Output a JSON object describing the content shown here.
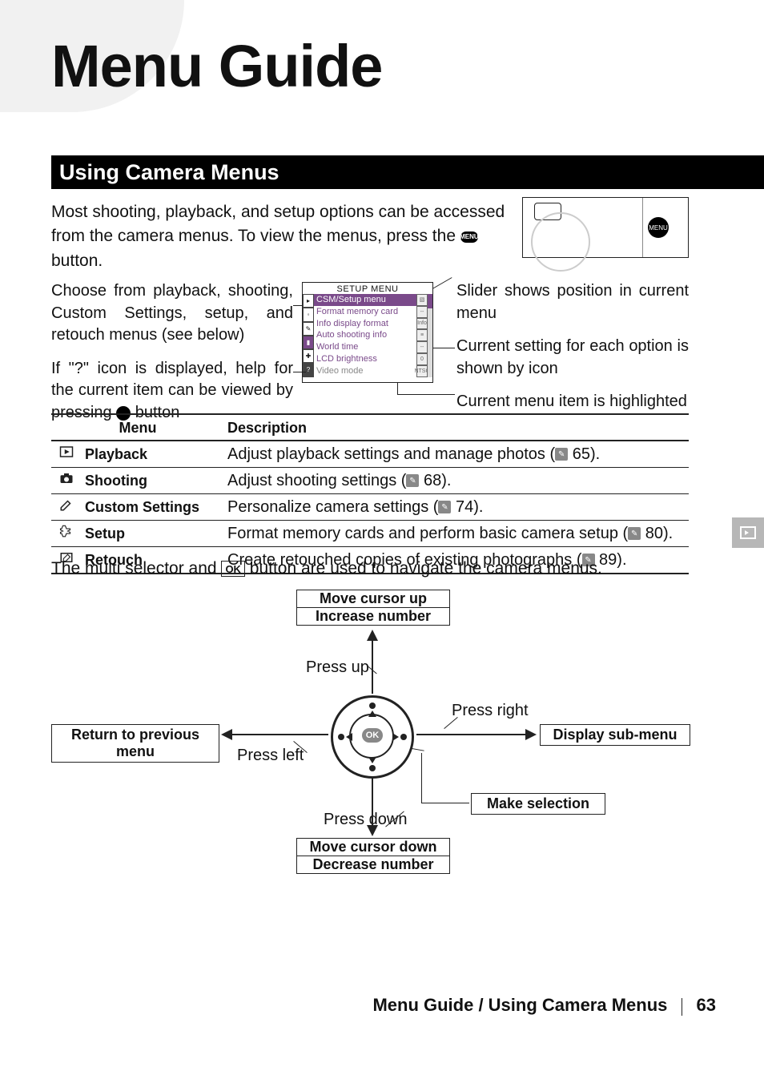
{
  "page": {
    "title": "Menu Guide",
    "section": "Using Camera Menus",
    "intro_a": "Most shooting, playback, and setup options can be accessed from the camera menus.  To view the menus, press the ",
    "intro_b": " button.",
    "menu_label": "MENU",
    "footer_breadcrumb": "Menu Guide / Using Camera Menus",
    "number": "63"
  },
  "callouts": {
    "left1": "Choose from playback, shooting, Custom Settings, setup, and retouch menus (see below)",
    "left2_a": "If \"?\" icon is displayed, help for the current item can be viewed by pressing ",
    "left2_b": " button",
    "right1": "Slider shows position in current menu",
    "right2": "Current setting for each option is shown by icon",
    "right3": "Current menu item is highlighted"
  },
  "screen": {
    "title": "SETUP MENU",
    "items": [
      {
        "label": "CSM/Setup menu",
        "hl": true
      },
      {
        "label": "Format memory card"
      },
      {
        "label": "Info display format"
      },
      {
        "label": "Auto shooting info"
      },
      {
        "label": "World time"
      },
      {
        "label": "LCD brightness"
      },
      {
        "label": "Video mode",
        "muted": true
      }
    ],
    "right_icons": [
      "▧",
      "--",
      "Info",
      "≡",
      "--",
      "0",
      "NTSC"
    ]
  },
  "table": {
    "headers": [
      "Menu",
      "Description"
    ],
    "rows": [
      {
        "icon": "playback",
        "name": "Playback",
        "desc_a": "Adjust playback settings and manage photos (",
        "desc_b": " 65)."
      },
      {
        "icon": "shooting",
        "name": "Shooting",
        "desc_a": "Adjust shooting settings (",
        "desc_b": " 68)."
      },
      {
        "icon": "custom",
        "name": "Custom Settings",
        "desc_a": "Personalize camera settings (",
        "desc_b": " 74)."
      },
      {
        "icon": "setup",
        "name": "Setup",
        "desc_a": "Format memory cards and perform basic camera setup (",
        "desc_b": " 80)."
      },
      {
        "icon": "retouch",
        "name": "Retouch",
        "desc_a": "Create retouched copies of existing photographs (",
        "desc_b": " 89)."
      }
    ]
  },
  "selector": {
    "text_a": "The multi selector and ",
    "ok": "OK",
    "text_b": " button are used to navigate the camera menus.",
    "up1": "Move cursor up",
    "up2": "Increase number",
    "down1": "Move cursor down",
    "down2": "Decrease number",
    "left": "Return to previous menu",
    "right": "Display sub-menu",
    "make": "Make selection",
    "press_up": "Press up",
    "press_down": "Press down",
    "press_left": "Press left",
    "press_right": "Press right"
  }
}
